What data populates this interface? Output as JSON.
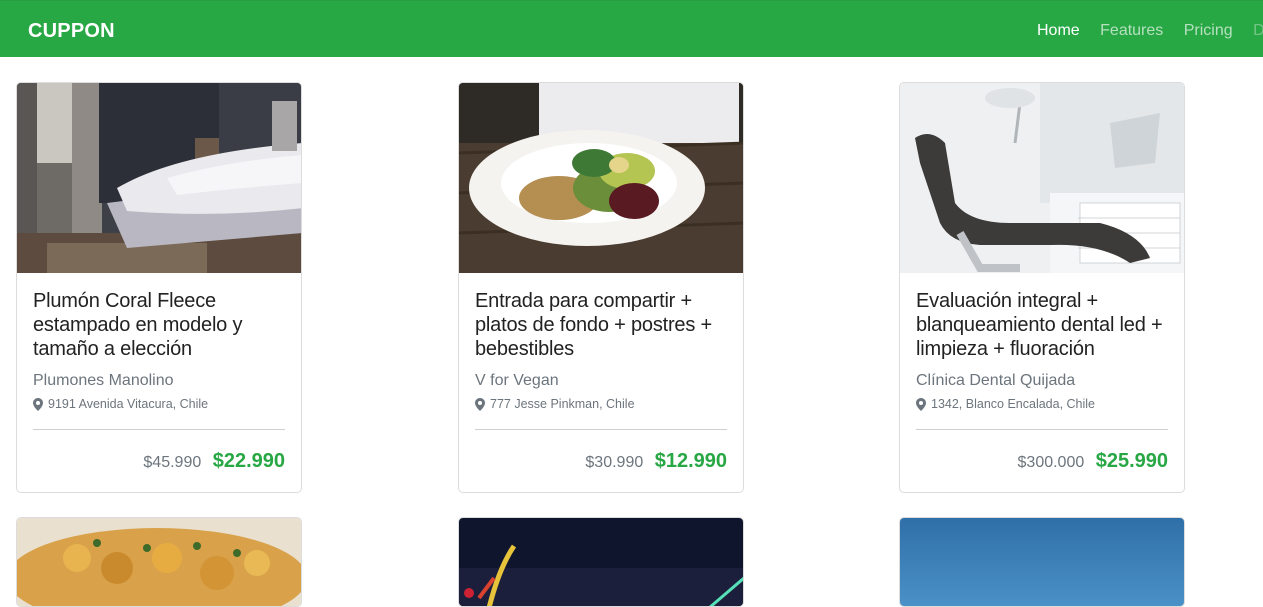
{
  "app": {
    "brand": "CUPPON"
  },
  "nav": {
    "items": [
      {
        "label": "Home",
        "state": "active"
      },
      {
        "label": "Features",
        "state": "normal"
      },
      {
        "label": "Pricing",
        "state": "normal"
      },
      {
        "label": "Disa",
        "state": "disabled"
      }
    ]
  },
  "colors": {
    "accent": "#28a745",
    "muted": "#6c757d"
  },
  "cards": [
    {
      "image": "bedroom-photo",
      "title": "Plumón Coral Fleece estampado en modelo y tamaño a elección",
      "merchant": "Plumones Manolino",
      "address": "9191 Avenida Vitacura, Chile",
      "old_price": "$45.990",
      "new_price": "$22.990"
    },
    {
      "image": "vegan-plate-photo",
      "title": "Entrada para compartir + platos de fondo + postres + bebestibles",
      "merchant": "V for Vegan",
      "address": "777 Jesse Pinkman, Chile",
      "old_price": "$30.990",
      "new_price": "$12.990"
    },
    {
      "image": "dental-chair-photo",
      "title": "Evaluación integral + blanqueamiento dental led + limpieza + fluoración",
      "merchant": "Clínica Dental Quijada",
      "address": "1342, Blanco Encalada, Chile",
      "old_price": "$300.000",
      "new_price": "$25.990"
    }
  ],
  "more_cards": [
    {
      "image": "food-closeup-photo"
    },
    {
      "image": "city-night-photo"
    },
    {
      "image": "blue-sky-photo"
    }
  ]
}
